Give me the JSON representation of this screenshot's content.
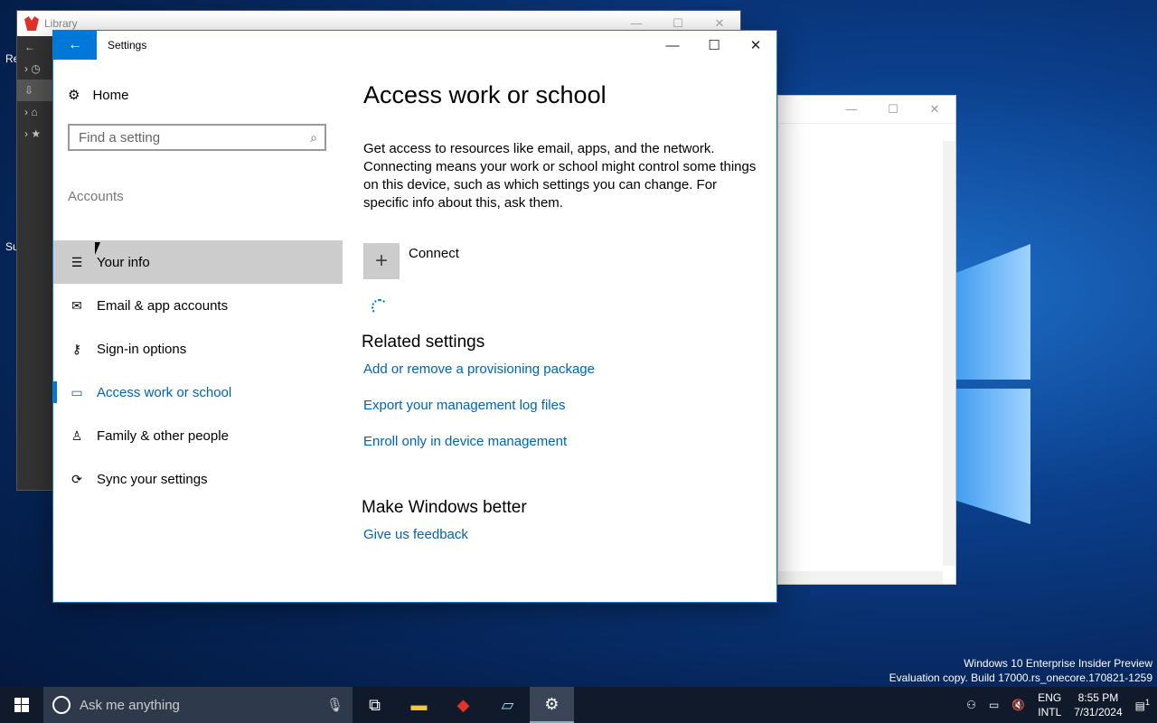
{
  "desktop": {
    "watermark_line1": "Windows 10 Enterprise Insider Preview",
    "watermark_line2": "Evaluation copy. Build 17000.rs_onecore.170821-1259",
    "icon_labels": [
      "Re",
      "Su"
    ]
  },
  "library_window": {
    "title": "Library",
    "min": "—",
    "max": "☐",
    "close": "✕"
  },
  "explorer_window": {
    "min": "—",
    "max": "☐",
    "close": "✕"
  },
  "settings": {
    "title": "Settings",
    "back_icon": "←",
    "min": "—",
    "max": "☐",
    "close": "✕",
    "nav": {
      "home": "Home",
      "search_placeholder": "Find a setting",
      "group": "Accounts",
      "items": [
        {
          "label": "Your info",
          "icon": "person-card-icon"
        },
        {
          "label": "Email & app accounts",
          "icon": "mail-icon"
        },
        {
          "label": "Sign-in options",
          "icon": "key-icon"
        },
        {
          "label": "Access work or school",
          "icon": "briefcase-icon"
        },
        {
          "label": "Family & other people",
          "icon": "person-add-icon"
        },
        {
          "label": "Sync your settings",
          "icon": "sync-icon"
        }
      ]
    },
    "content": {
      "title": "Access work or school",
      "description": "Get access to resources like email, apps, and the network. Connecting means your work or school might control some things on this device, such as which settings you can change. For specific info about this, ask them.",
      "connect_label": "Connect",
      "related_heading": "Related settings",
      "related_links": [
        "Add or remove a provisioning package",
        "Export your management log files",
        "Enroll only in device management"
      ],
      "better_heading": "Make Windows better",
      "feedback_link": "Give us feedback"
    }
  },
  "taskbar": {
    "search_placeholder": "Ask me anything",
    "lang_top": "ENG",
    "lang_bottom": "INTL",
    "time": "8:55 PM",
    "date": "7/31/2024",
    "notification_count": "1"
  }
}
